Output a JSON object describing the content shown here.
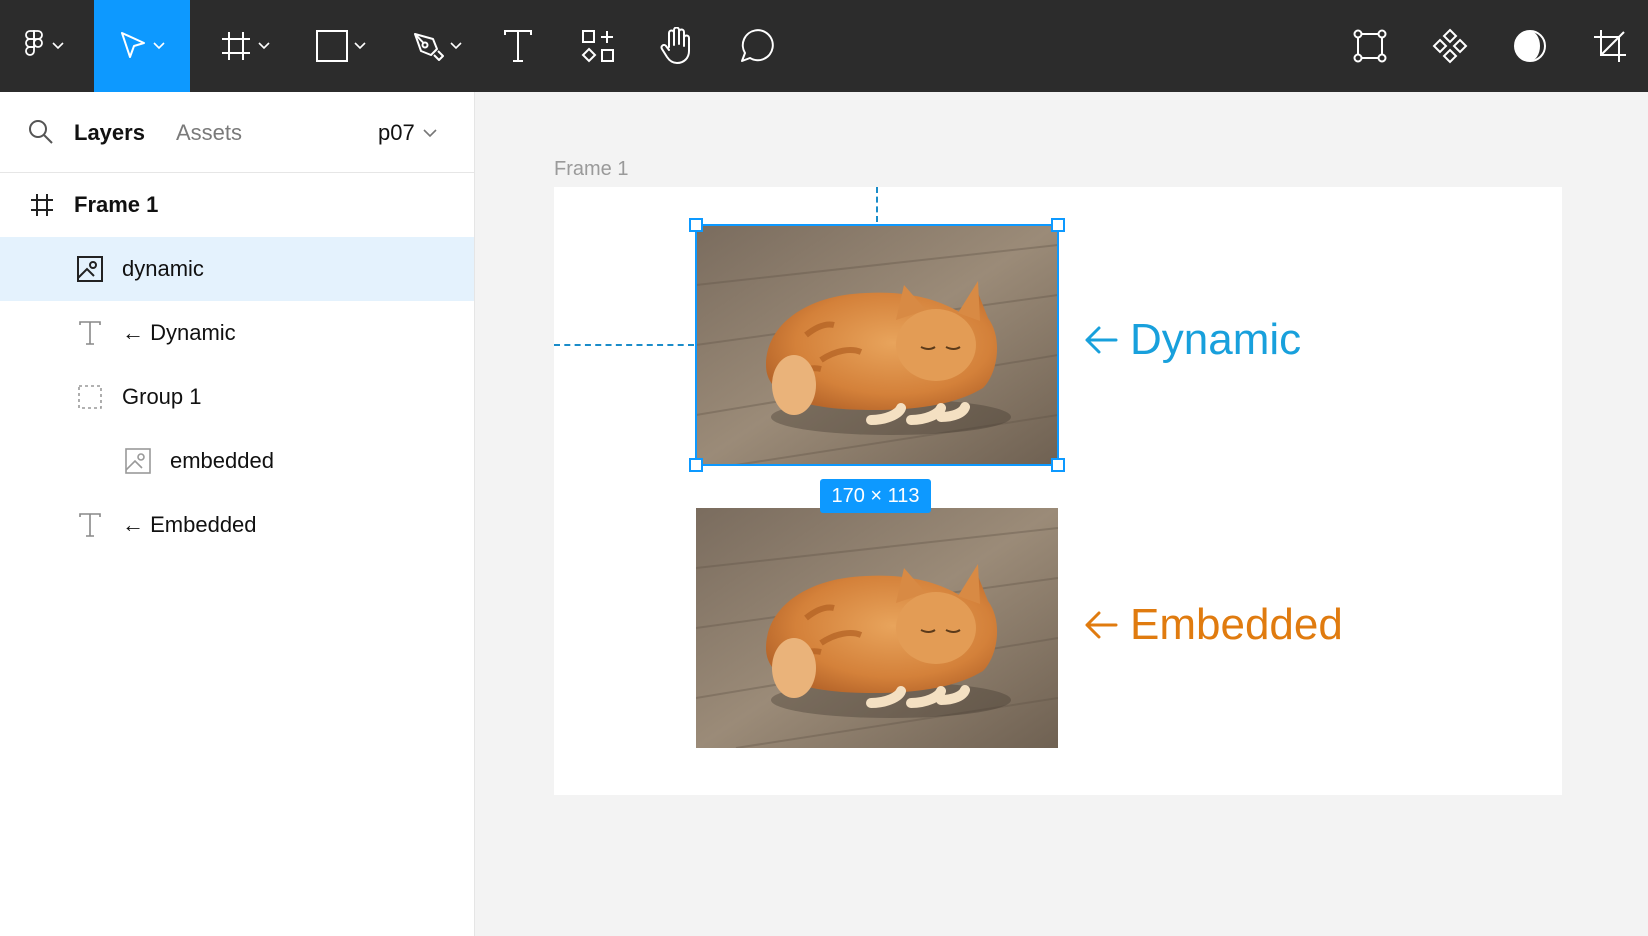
{
  "colors": {
    "toolbar_bg": "#2c2c2c",
    "active_tool": "#0d99ff",
    "selection": "#0d99ff",
    "dynamic_label": "#18a0dc",
    "embedded_label": "#e07b0f",
    "selected_layer_bg": "#e4f2fd"
  },
  "toolbar": {
    "left_tools": [
      {
        "icon": "figma-logo-icon",
        "has_menu": true
      },
      {
        "icon": "move-pointer-icon",
        "has_menu": true,
        "active": true
      },
      {
        "icon": "frame-hash-icon",
        "has_menu": true
      },
      {
        "icon": "rectangle-icon",
        "has_menu": true
      },
      {
        "icon": "pen-icon",
        "has_menu": true
      },
      {
        "icon": "text-icon",
        "has_menu": false
      },
      {
        "icon": "resources-icon",
        "has_menu": false
      },
      {
        "icon": "hand-icon",
        "has_menu": false
      },
      {
        "icon": "comment-icon",
        "has_menu": false
      }
    ],
    "right_tools": [
      {
        "icon": "edit-object-icon"
      },
      {
        "icon": "component-icon"
      },
      {
        "icon": "mask-contrast-icon"
      },
      {
        "icon": "crop-icon"
      }
    ]
  },
  "panel": {
    "tabs": {
      "layers": "Layers",
      "assets": "Assets"
    },
    "page": "p07",
    "layers": [
      {
        "name": "Frame 1",
        "type": "frame",
        "icon": "frame-hash-icon",
        "bold": true,
        "selected": false
      },
      {
        "name": "dynamic",
        "type": "image",
        "icon": "image-icon",
        "selected": true
      },
      {
        "name": "← Dynamic",
        "type": "text",
        "icon": "text-icon",
        "selected": false
      },
      {
        "name": "Group 1",
        "type": "group",
        "icon": "group-dashed-icon",
        "selected": false
      },
      {
        "name": "embedded",
        "type": "image",
        "icon": "image-icon",
        "selected": false
      },
      {
        "name": "← Embedded",
        "type": "text",
        "icon": "text-icon",
        "selected": false
      }
    ]
  },
  "canvas": {
    "frame_label": "Frame 1",
    "selection_size": "170 × 113",
    "callouts": {
      "dynamic": "Dynamic",
      "embedded": "Embedded"
    }
  }
}
